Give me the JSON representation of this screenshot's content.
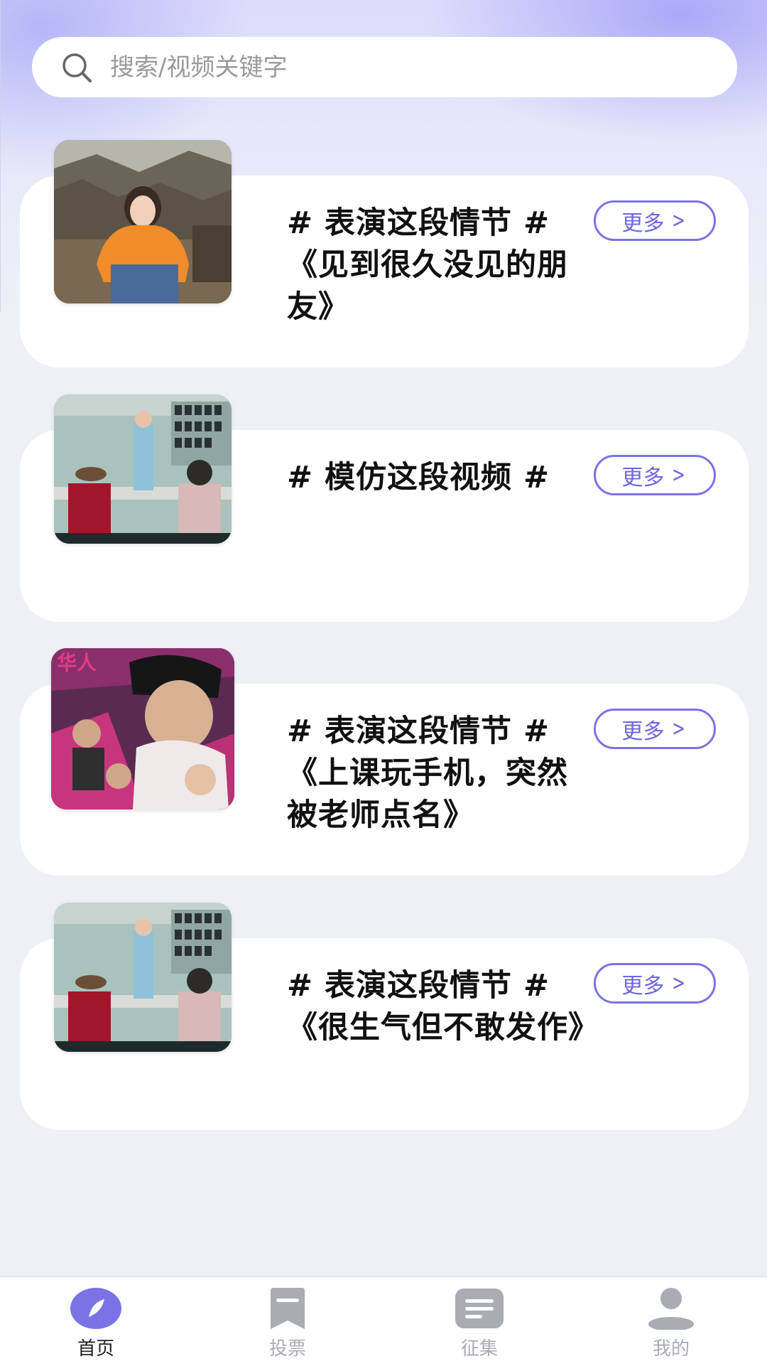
{
  "search": {
    "placeholder": "搜索/视频关键字"
  },
  "cards": [
    {
      "title": "# 表演这段情节 #《见到很久没见的朋友》",
      "more_label": "更多",
      "thumbnail": "girl-orange-sweater-village"
    },
    {
      "title": "# 模仿这段视频 #",
      "more_label": "更多",
      "thumbnail": "audition-room-scene"
    },
    {
      "title": "# 表演这段情节 #《上课玩手机，突然被老师点名》",
      "more_label": "更多",
      "thumbnail": "movie-poster-man-cap"
    },
    {
      "title": "# 表演这段情节 #《很生气但不敢发作》",
      "more_label": "更多",
      "thumbnail": "audition-room-scene"
    }
  ],
  "nav": {
    "items": [
      {
        "label": "首页",
        "icon": "home-icon",
        "active": true
      },
      {
        "label": "投票",
        "icon": "vote-icon",
        "active": false
      },
      {
        "label": "征集",
        "icon": "collect-icon",
        "active": false
      },
      {
        "label": "我的",
        "icon": "profile-icon",
        "active": false
      }
    ]
  },
  "colors": {
    "accent": "#7b72e6",
    "background": "#edf1f6",
    "nav_inactive": "#a8acb3"
  }
}
